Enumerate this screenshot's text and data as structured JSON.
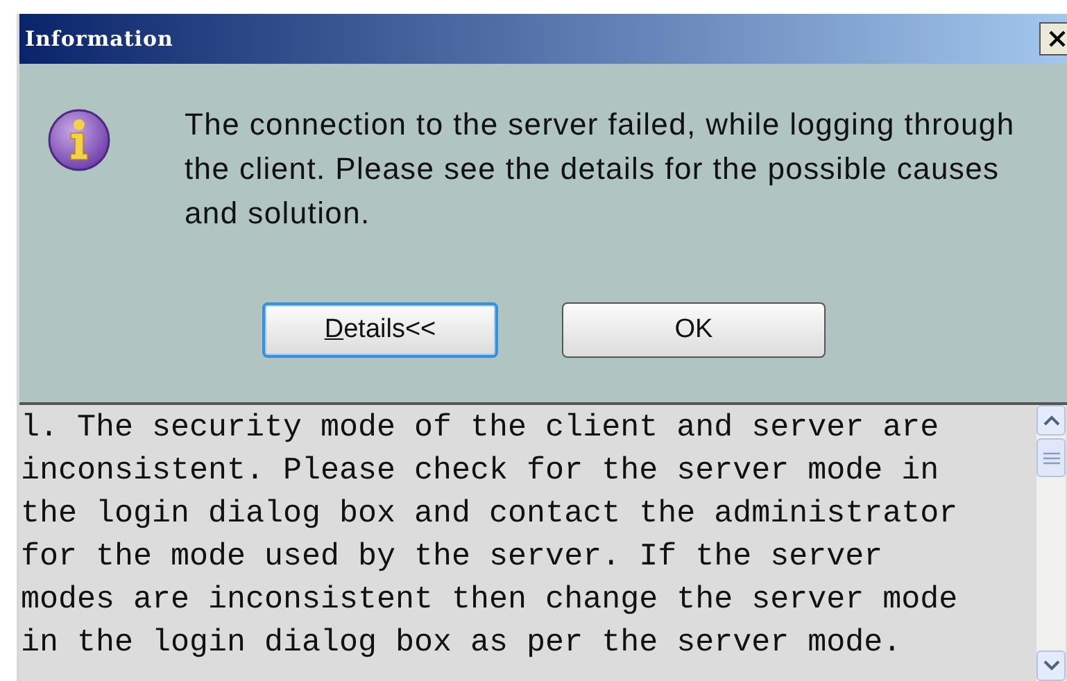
{
  "window": {
    "title": "Information"
  },
  "message": "The connection to the server failed, while logging through\nthe client. Please see the details for the possible causes\nand solution.",
  "buttons": [
    {
      "label": "Details<<",
      "first_letter_underlined": true,
      "focused": true
    },
    {
      "label": "OK",
      "focused": false
    }
  ],
  "details": "l. The security mode of the client and server are\ninconsistent. Please check for the server mode in\nthe login dialog box and contact the administrator\nfor the mode used by the server. If the server\nmodes are inconsistent then change the server mode\nin the login dialog box as per the server mode."
}
